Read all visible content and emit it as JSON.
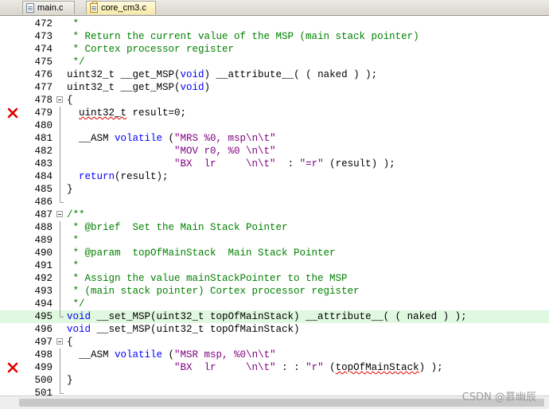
{
  "tabs": [
    {
      "label": "main.c",
      "active": false,
      "icon": "file-icon"
    },
    {
      "label": "core_cm3.c",
      "active": true,
      "icon": "read-only-file-icon"
    }
  ],
  "lines": [
    {
      "num": "472",
      "text": " *",
      "kind": "comment"
    },
    {
      "num": "473",
      "text": " * Return the current value of the MSP (main stack pointer)",
      "kind": "comment"
    },
    {
      "num": "474",
      "text": " * Cortex processor register",
      "kind": "comment"
    },
    {
      "num": "475",
      "text": " */",
      "kind": "comment"
    },
    {
      "num": "476",
      "text": "uint32_t __get_MSP(void) __attribute__( ( naked ) );",
      "kind": "code"
    },
    {
      "num": "477",
      "text": "uint32_t __get_MSP(void)",
      "kind": "code"
    },
    {
      "num": "478",
      "text": "{",
      "kind": "code"
    },
    {
      "num": "479",
      "text": "  uint32_t result=0;",
      "kind": "code",
      "error": true
    },
    {
      "num": "480",
      "text": "",
      "kind": "code"
    },
    {
      "num": "481",
      "text": "  __ASM volatile (\"MRS %0, msp\\n\\t\"",
      "kind": "code"
    },
    {
      "num": "482",
      "text": "                  \"MOV r0, %0 \\n\\t\"",
      "kind": "code"
    },
    {
      "num": "483",
      "text": "                  \"BX  lr     \\n\\t\"  : \"=r\" (result) );",
      "kind": "code"
    },
    {
      "num": "484",
      "text": "  return(result);",
      "kind": "code"
    },
    {
      "num": "485",
      "text": "}",
      "kind": "code"
    },
    {
      "num": "486",
      "text": "",
      "kind": "code"
    },
    {
      "num": "487",
      "text": "/**",
      "kind": "comment"
    },
    {
      "num": "488",
      "text": " * @brief  Set the Main Stack Pointer",
      "kind": "comment"
    },
    {
      "num": "489",
      "text": " *",
      "kind": "comment"
    },
    {
      "num": "490",
      "text": " * @param  topOfMainStack  Main Stack Pointer",
      "kind": "comment"
    },
    {
      "num": "491",
      "text": " *",
      "kind": "comment"
    },
    {
      "num": "492",
      "text": " * Assign the value mainStackPointer to the MSP",
      "kind": "comment"
    },
    {
      "num": "493",
      "text": " * (main stack pointer) Cortex processor register",
      "kind": "comment"
    },
    {
      "num": "494",
      "text": " */",
      "kind": "comment"
    },
    {
      "num": "495",
      "text": "void __set_MSP(uint32_t topOfMainStack) __attribute__( ( naked ) );",
      "kind": "code",
      "highlight": true
    },
    {
      "num": "496",
      "text": "void __set_MSP(uint32_t topOfMainStack)",
      "kind": "code"
    },
    {
      "num": "497",
      "text": "{",
      "kind": "code"
    },
    {
      "num": "498",
      "text": "  __ASM volatile (\"MSR msp, %0\\n\\t\"",
      "kind": "code"
    },
    {
      "num": "499",
      "text": "                  \"BX  lr     \\n\\t\" : : \"r\" (topOfMainStack) );",
      "kind": "code",
      "error": true
    },
    {
      "num": "500",
      "text": "}",
      "kind": "code"
    },
    {
      "num": "501",
      "text": "",
      "kind": "code"
    }
  ],
  "watermark": "CSDN @慕幽辰",
  "colors": {
    "comment": "#008000",
    "keyword": "#0000ff",
    "string": "#800080",
    "highlight_line": "#e0f8e0",
    "error_mark": "#e00000"
  }
}
